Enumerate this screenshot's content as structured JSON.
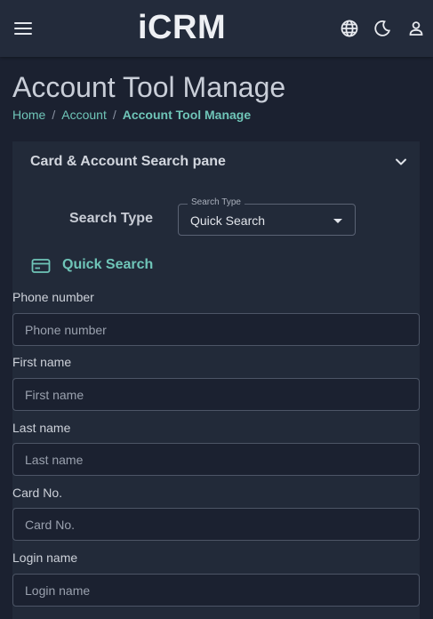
{
  "app": {
    "logo": "iCRM"
  },
  "header": {
    "icons": [
      "menu-icon",
      "globe-icon",
      "moon-icon",
      "user-icon"
    ]
  },
  "page": {
    "title": "Account Tool Manage"
  },
  "breadcrumb": {
    "items": [
      "Home",
      "Account"
    ],
    "current": "Account Tool Manage",
    "separator": "/"
  },
  "panel": {
    "title": "Card & Account Search pane",
    "search_type": {
      "label": "Search Type",
      "legend": "Search Type",
      "value": "Quick Search"
    },
    "quick_search": {
      "title": "Quick Search",
      "icon": "card-icon"
    },
    "fields": [
      {
        "label": "Phone number",
        "placeholder": "Phone number",
        "value": ""
      },
      {
        "label": "First name",
        "placeholder": "First name",
        "value": ""
      },
      {
        "label": "Last name",
        "placeholder": "Last name",
        "value": ""
      },
      {
        "label": "Card No.",
        "placeholder": "Card No.",
        "value": ""
      },
      {
        "label": "Login name",
        "placeholder": "Login name",
        "value": ""
      }
    ]
  },
  "colors": {
    "accent": "#6fc5b8",
    "background": "#1b2130",
    "topbar": "#232b3b",
    "panel": "#222a39"
  }
}
